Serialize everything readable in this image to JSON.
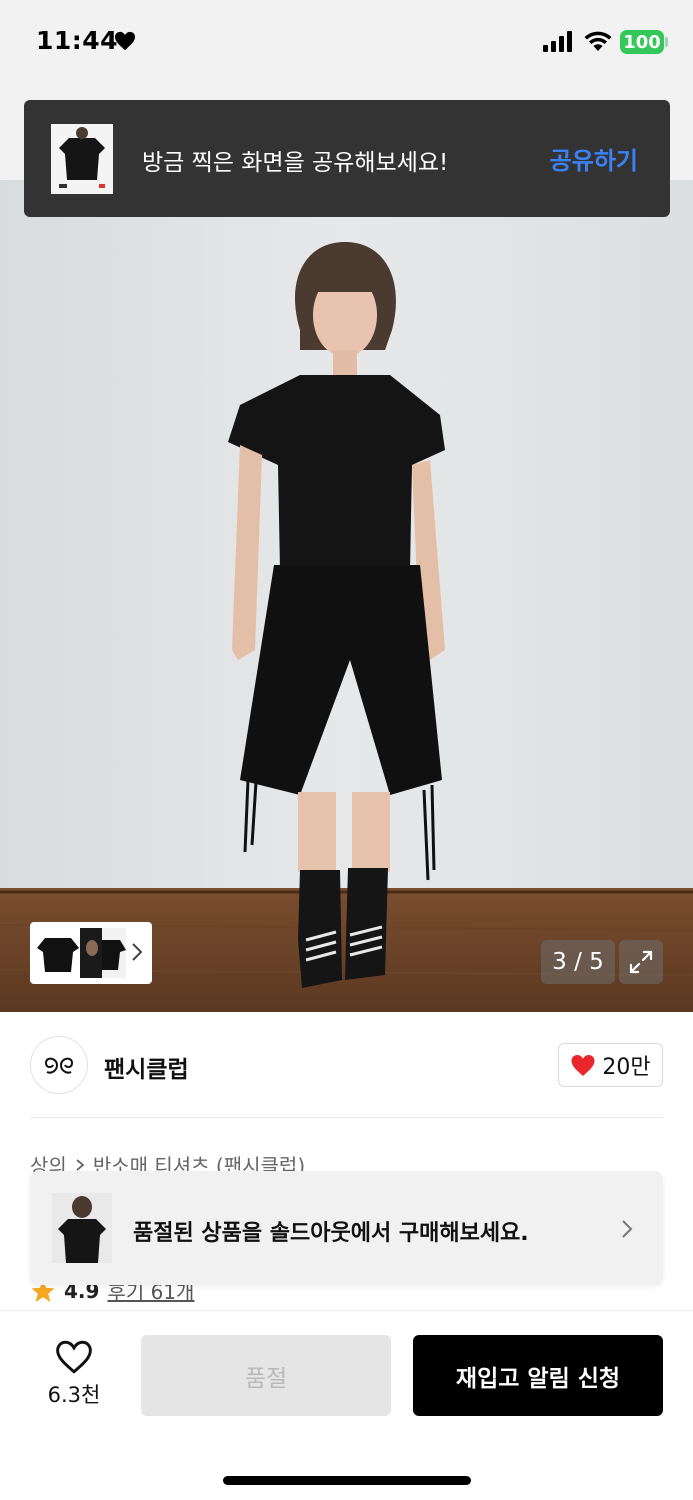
{
  "status_bar": {
    "time": "11:44",
    "battery": "100"
  },
  "share_toast": {
    "message": "방금 찍은 화면을 공유해보세요!",
    "action": "공유하기"
  },
  "gallery": {
    "counter": "3 / 5"
  },
  "brand": {
    "name": "팬시클럽",
    "likes": "20만",
    "accent_color": "#e8262b"
  },
  "breadcrumb": {
    "items": [
      "상의",
      "반소매 티셔츠 (팬시클럽)"
    ]
  },
  "soldout_banner": {
    "message": "품절된 상품을 솔드아웃에서 구매해보세요."
  },
  "rating": {
    "score": "4.9",
    "reviews": "후기 61개"
  },
  "bottom_bar": {
    "wish_count": "6.3천",
    "soldout_label": "품절",
    "restock_label": "재입고 알림 신청"
  },
  "colors": {
    "share_link": "#3b82f6",
    "battery": "#34c759",
    "primary_button": "#000000"
  }
}
